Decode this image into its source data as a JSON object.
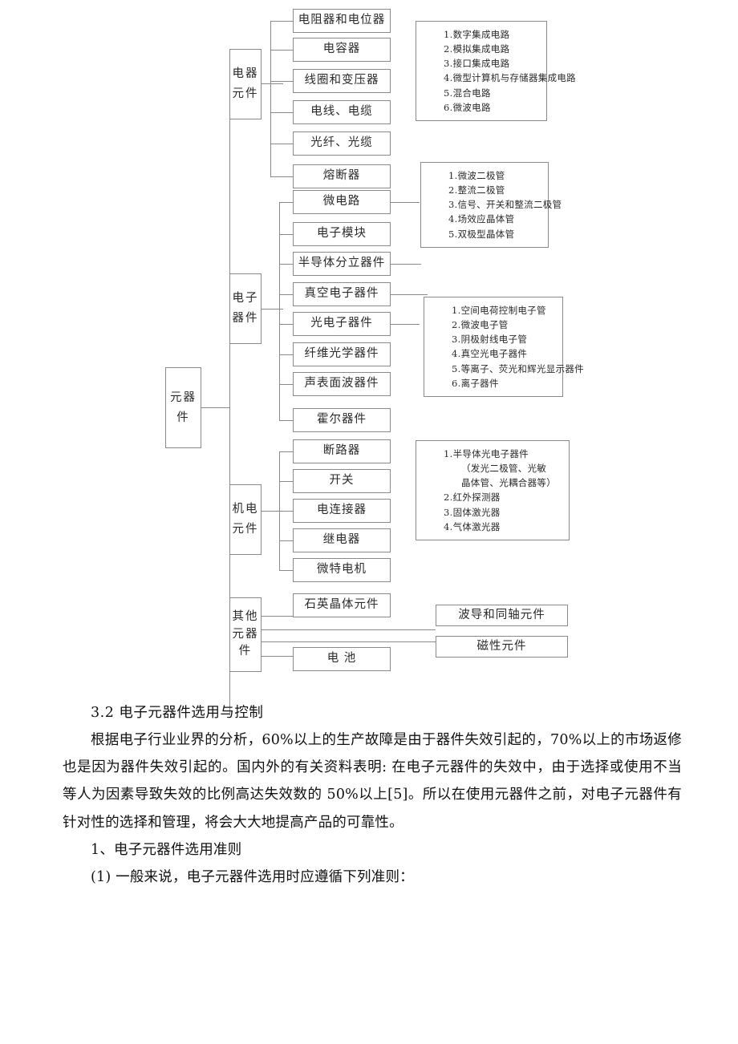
{
  "diagram": {
    "root": "元器件",
    "groups": [
      {
        "label": "电器\n元件"
      },
      {
        "label": "电子\n器件"
      },
      {
        "label": "机电\n元件"
      },
      {
        "label": "其他\n元器\n件"
      }
    ],
    "group_labels": {
      "electrical": "电器 元件",
      "electronic": "电子 器件",
      "electromechanical": "机电 元件",
      "other": "其他 元器 件"
    },
    "leaves": {
      "electrical": [
        "电阻器和电位器",
        "电容器",
        "线圈和变压器",
        "电线、电缆",
        "光纤、光缆",
        "熔断器"
      ],
      "electronic": [
        "微电路",
        "电子模块",
        "半导体分立器件",
        "真空电子器件",
        "光电子器件",
        "纤维光学器件",
        "声表面波器件",
        "霍尔器件"
      ],
      "electromechanical": [
        "断路器",
        "开关",
        "电连接器",
        "继电器",
        "微特电机"
      ],
      "other": [
        "石英晶体元件",
        "电 池"
      ],
      "other_right": [
        "波导和同轴元件",
        "磁性元件"
      ]
    },
    "detail_lists": [
      {
        "id": "microcircuit-list",
        "items": [
          "1.数字集成电路",
          "2.模拟集成电路",
          "3.接口集成电路",
          "4.微型计算机与存储器集成电路",
          "5.混合电路",
          "6.微波电路"
        ]
      },
      {
        "id": "semiconductor-list",
        "items": [
          "1.微波二极管",
          "2.整流二极管",
          "3.信号、开关和整流二极管",
          "4.场效应晶体管",
          "5.双极型晶体管"
        ]
      },
      {
        "id": "vacuum-list",
        "items": [
          "1.空间电荷控制电子管",
          "2.微波电子管",
          "3.阴极射线电子管",
          "4.真空光电子器件",
          "5.等离子、荧光和辉光显示器件",
          "6.离子器件"
        ]
      },
      {
        "id": "optoelectronic-list",
        "items": [
          "1.半导体光电子器件",
          "（发光二极管、光敏",
          "晶体管、光耦合器等）",
          "2.红外探测器",
          "3.固体激光器",
          "4.气体激光器"
        ],
        "indented": [
          1,
          2
        ]
      }
    ]
  },
  "body": {
    "heading": "3.2  电子元器件选用与控制",
    "paragraph": "根据电子行业业界的分析，60%以上的生产故障是由于器件失效引起的，70%以上的市场返修也是因为器件失效引起的。国内外的有关资料表明: 在电子元器件的失效中，由于选择或使用不当等人为因素导致失效的比例高达失效数的 50%以上[5]。所以在使用元器件之前，对电子元器件有针对性的选择和管理，将会大大地提高产品的可靠性。",
    "item1": "1、电子元器件选用准则",
    "item2": "(1) 一般来说，电子元器件选用时应遵循下列准则："
  }
}
